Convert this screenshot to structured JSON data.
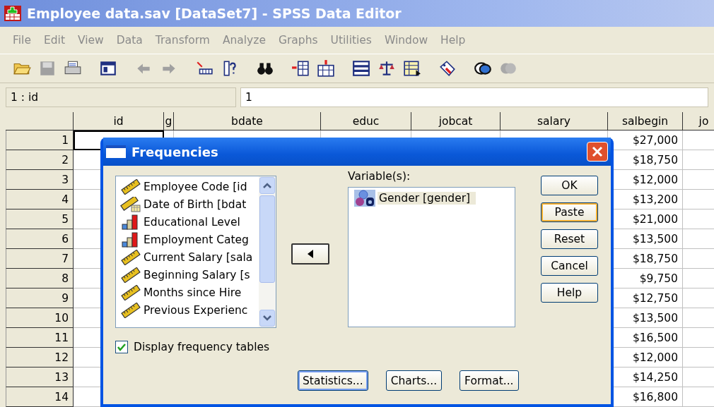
{
  "window": {
    "title": "Employee data.sav [DataSet7] - SPSS Data Editor"
  },
  "menu": [
    "File",
    "Edit",
    "View",
    "Data",
    "Transform",
    "Analyze",
    "Graphs",
    "Utilities",
    "Window",
    "Help"
  ],
  "cell_editor": {
    "reference": "1 : id",
    "value": "1"
  },
  "grid": {
    "columns": [
      "id",
      "g",
      "bdate",
      "educ",
      "jobcat",
      "salary",
      "salbegin",
      "jo"
    ],
    "rows": [
      {
        "number": "1",
        "salbegin": "$27,000"
      },
      {
        "number": "2",
        "salbegin": "$18,750"
      },
      {
        "number": "3",
        "salbegin": "$12,000"
      },
      {
        "number": "4",
        "salbegin": "$13,200"
      },
      {
        "number": "5",
        "salbegin": "$21,000"
      },
      {
        "number": "6",
        "salbegin": "$13,500"
      },
      {
        "number": "7",
        "salbegin": "$18,750"
      },
      {
        "number": "8",
        "salbegin": "$9,750"
      },
      {
        "number": "9",
        "salbegin": "$12,750"
      },
      {
        "number": "10",
        "salbegin": "$13,500"
      },
      {
        "number": "11",
        "salbegin": "$16,500"
      },
      {
        "number": "12",
        "salbegin": "$12,000"
      },
      {
        "number": "13",
        "salbegin": "$14,250"
      },
      {
        "number": "14",
        "salbegin": "$16,800"
      }
    ]
  },
  "dialog": {
    "title": "Frequencies",
    "source_variables": [
      {
        "label": "Employee Code [id",
        "kind": "scale"
      },
      {
        "label": "Date of Birth [bdat",
        "kind": "date"
      },
      {
        "label": "Educational Level",
        "kind": "ordinal"
      },
      {
        "label": "Employment Categ",
        "kind": "ordinal"
      },
      {
        "label": "Current Salary [sala",
        "kind": "scale"
      },
      {
        "label": "Beginning Salary [s",
        "kind": "scale"
      },
      {
        "label": "Months since Hire",
        "kind": "scale"
      },
      {
        "label": "Previous Experienc",
        "kind": "scale"
      }
    ],
    "target_label": "Variable(s):",
    "target_variables": [
      {
        "label": "Gender [gender]",
        "kind": "nominal",
        "selected": true
      }
    ],
    "side_buttons": [
      {
        "label": "OK",
        "focused": false
      },
      {
        "label": "Paste",
        "focused": true
      },
      {
        "label": "Reset",
        "focused": false
      },
      {
        "label": "Cancel",
        "focused": false
      },
      {
        "label": "Help",
        "focused": false
      }
    ],
    "display_frequency_tables": {
      "label": "Display frequency tables",
      "checked": true
    },
    "bottom_buttons": [
      {
        "label": "Statistics...",
        "focused": true
      },
      {
        "label": "Charts...",
        "focused": false
      },
      {
        "label": "Format...",
        "focused": false
      }
    ]
  }
}
